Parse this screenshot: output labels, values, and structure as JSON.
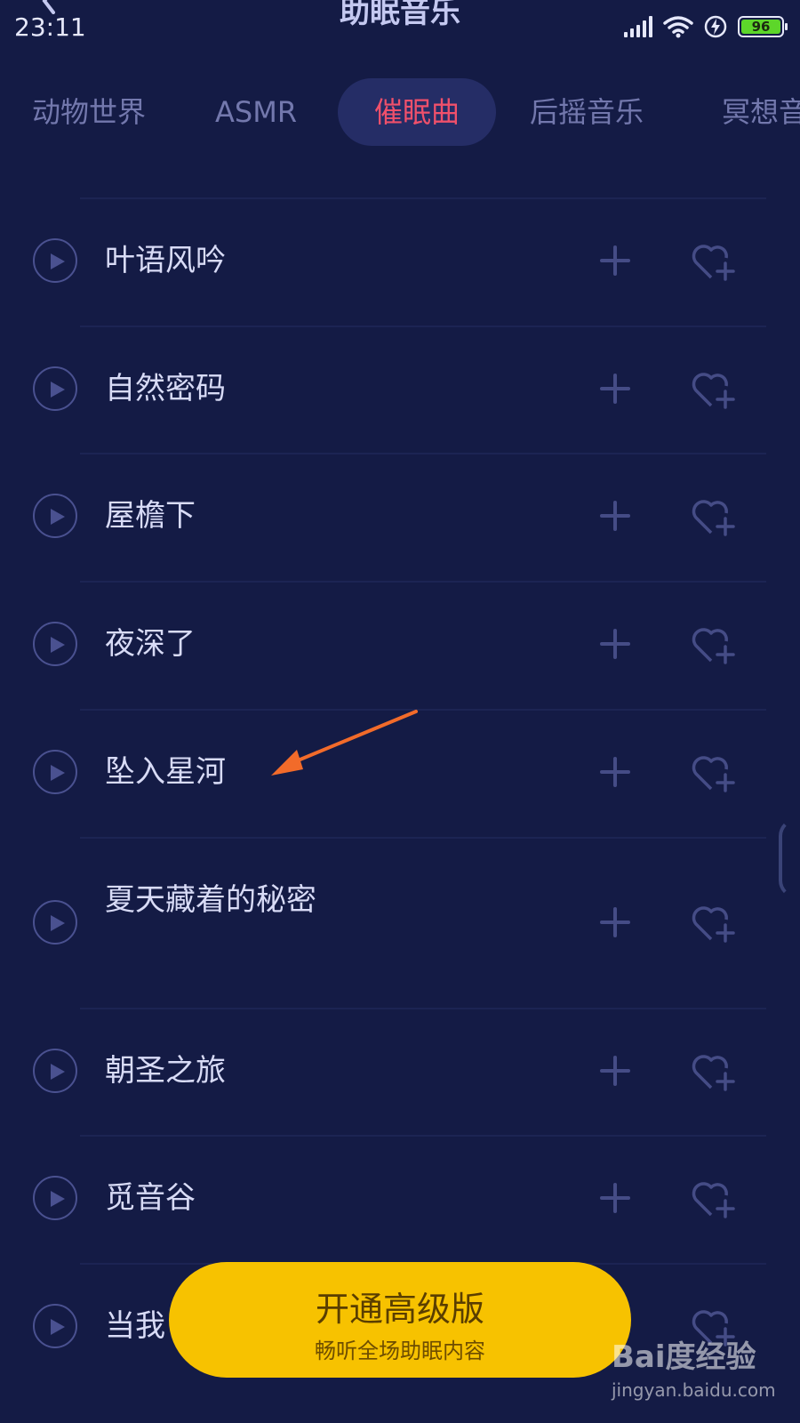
{
  "status_bar": {
    "time": "23:11",
    "battery": "96",
    "battery_color": "#5dd62a"
  },
  "header": {
    "title": "助眠音乐"
  },
  "tabs": [
    {
      "label": "动物世界"
    },
    {
      "label": "ASMR"
    },
    {
      "label": "催眠曲",
      "active": true
    },
    {
      "label": "后摇音乐"
    },
    {
      "label": "冥想音"
    }
  ],
  "songs": [
    {
      "title": "叶语风吟"
    },
    {
      "title": "自然密码"
    },
    {
      "title": "屋檐下"
    },
    {
      "title": "夜深了"
    },
    {
      "title": "坠入星河"
    },
    {
      "title": "夏天藏着的秘密"
    },
    {
      "title": "朝圣之旅"
    },
    {
      "title": "觅音谷"
    },
    {
      "title": "当我"
    }
  ],
  "icons": {
    "play": "play-icon",
    "add": "plus-icon",
    "favorite": "heart-plus-icon"
  },
  "premium": {
    "title": "开通高级版",
    "subtitle": "畅听全场助眠内容",
    "color": "#f7c200"
  },
  "watermark": {
    "logo": "Bai度经验",
    "url": "jingyan.baidu.com"
  },
  "colors": {
    "background": "#141b45",
    "active_tab_text": "#f0506b",
    "annotation_arrow": "#f26b2a"
  }
}
